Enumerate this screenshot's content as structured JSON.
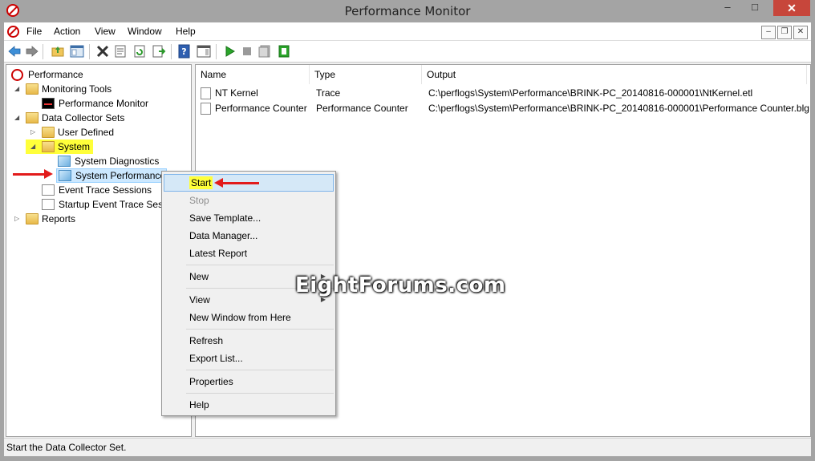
{
  "window": {
    "title": "Performance Monitor"
  },
  "menubar": {
    "items": [
      "File",
      "Action",
      "View",
      "Window",
      "Help"
    ]
  },
  "toolbar": {
    "buttons": [
      "back-icon",
      "forward-icon",
      "up-folder-icon",
      "show-hide-tree-icon",
      "delete-icon",
      "properties-icon",
      "refresh-icon",
      "export-icon",
      "help-icon",
      "show-hide-action-pane-icon",
      "start-icon",
      "stop-icon",
      "latest-report-icon",
      "new-item-icon"
    ]
  },
  "tree": {
    "root": "Performance",
    "monitoring_tools": "Monitoring Tools",
    "performance_monitor": "Performance Monitor",
    "data_collector_sets": "Data Collector Sets",
    "user_defined": "User Defined",
    "system": "System",
    "system_diagnostics": "System Diagnostics",
    "system_performance": "System Performance",
    "event_trace_sessions": "Event Trace Sessions",
    "startup_event_trace_sessions": "Startup Event Trace Sessi",
    "reports": "Reports"
  },
  "list": {
    "columns": [
      "Name",
      "Type",
      "Output"
    ],
    "rows": [
      {
        "name": "NT Kernel",
        "type": "Trace",
        "output": "C:\\perflogs\\System\\Performance\\BRINK-PC_20140816-000001\\NtKernel.etl"
      },
      {
        "name": "Performance Counter",
        "type": "Performance Counter",
        "output": "C:\\perflogs\\System\\Performance\\BRINK-PC_20140816-000001\\Performance Counter.blg"
      }
    ]
  },
  "context_menu": {
    "items": {
      "start": "Start",
      "stop": "Stop",
      "save_template": "Save Template...",
      "data_manager": "Data Manager...",
      "latest_report": "Latest Report",
      "new": "New",
      "view": "View",
      "new_window": "New Window from Here",
      "refresh": "Refresh",
      "export_list": "Export List...",
      "properties": "Properties",
      "help": "Help"
    }
  },
  "status": {
    "text": "Start the Data Collector Set."
  },
  "watermark": "EightForums.com",
  "colors": {
    "highlight": "#ffff3a",
    "arrow": "#e21b1b",
    "selection": "#d5e8f7"
  }
}
